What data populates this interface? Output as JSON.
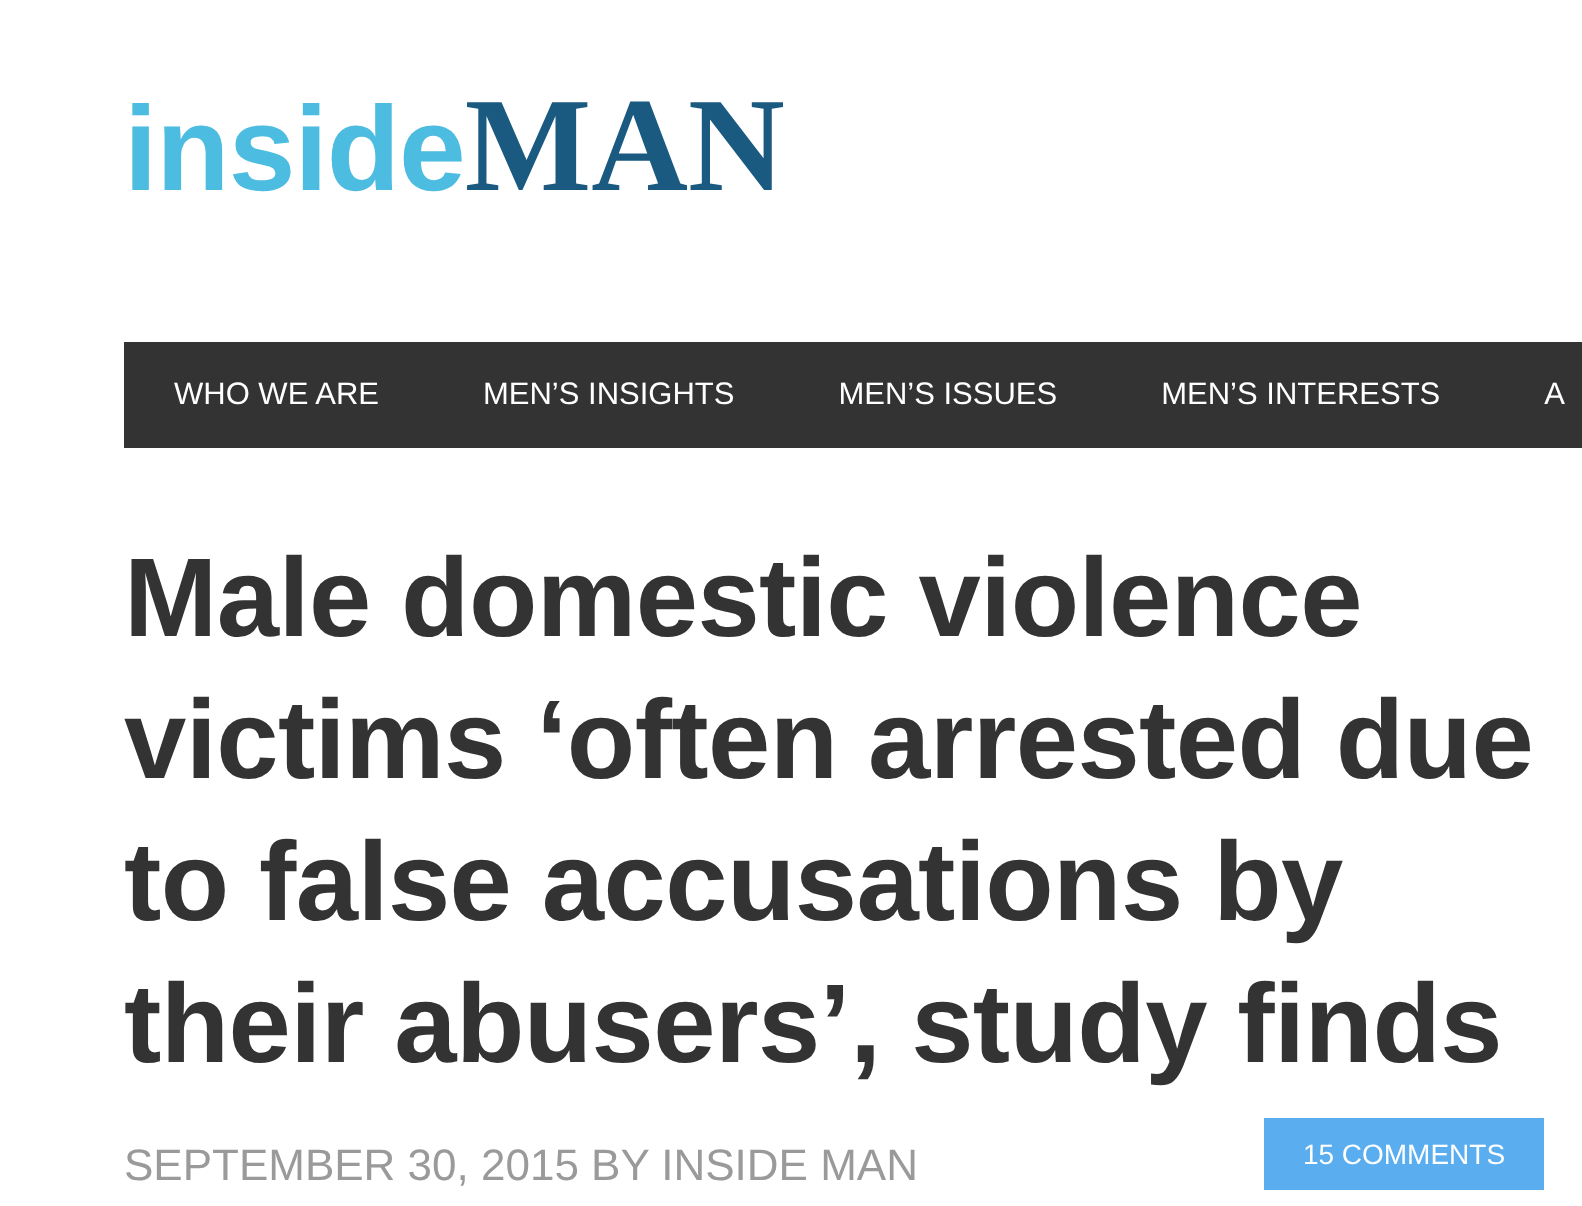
{
  "logo": {
    "part_1": "inside",
    "part_2": "MAN"
  },
  "nav": {
    "items": [
      {
        "label": "WHO WE ARE"
      },
      {
        "label": "MEN’S INSIGHTS"
      },
      {
        "label": "MEN’S ISSUES"
      },
      {
        "label": "MEN’S INTERESTS"
      },
      {
        "label": "A"
      }
    ]
  },
  "article": {
    "title": "Male domestic violence victims ‘often arrested due to false accusations by their abusers’, study finds",
    "meta": "SEPTEMBER 30, 2015 BY INSIDE MAN",
    "comments_button": "15 COMMENTS"
  }
}
